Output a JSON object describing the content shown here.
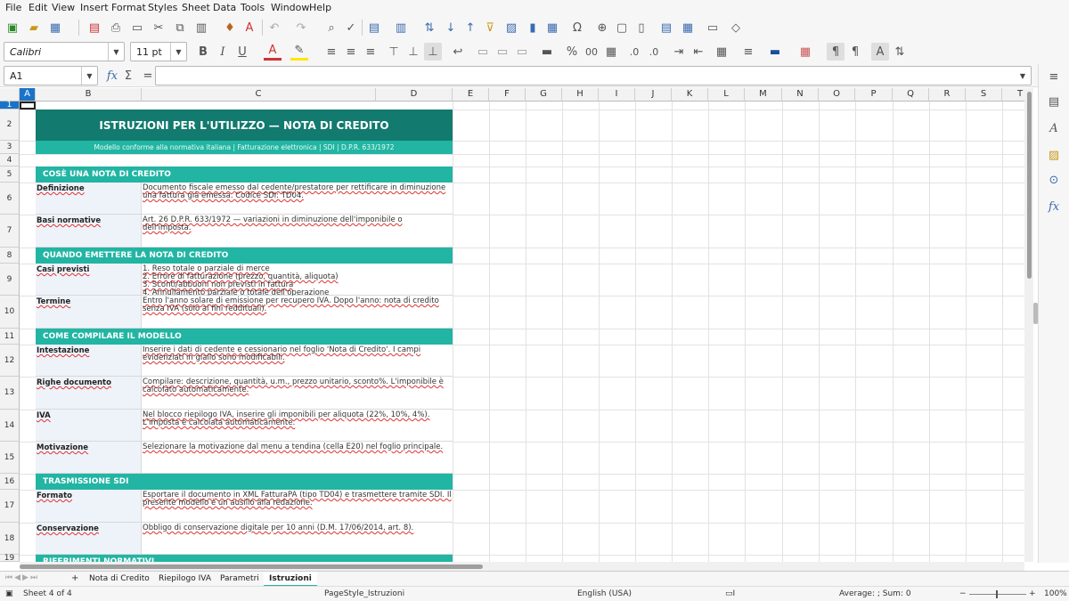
{
  "menu": [
    "File",
    "Edit",
    "View",
    "Insert",
    "Format",
    "Styles",
    "Sheet",
    "Data",
    "Tools",
    "Window",
    "Help"
  ],
  "toolbar": {
    "font_name": "Calibri",
    "font_size": "11 pt",
    "bold": "B",
    "italic": "I",
    "underline": "U"
  },
  "formula_bar": {
    "cell_ref": "A1",
    "fx_label": "fx",
    "sigma_label": "Σ",
    "equals_label": "=",
    "content": ""
  },
  "columns": [
    "A",
    "B",
    "C",
    "D",
    "E",
    "F",
    "G",
    "H",
    "I",
    "J",
    "K",
    "L",
    "M",
    "N",
    "O",
    "P",
    "Q",
    "R",
    "S",
    "T"
  ],
  "rows": [
    "1",
    "2",
    "3",
    "4",
    "5",
    "6",
    "7",
    "8",
    "9",
    "10",
    "11",
    "12",
    "13",
    "14",
    "15",
    "16",
    "17",
    "18",
    "19"
  ],
  "sheet": {
    "title": "ISTRUZIONI PER L'UTILIZZO — NOTA DI CREDITO",
    "subtitle": "Modello conforme alla normativa italiana | Fatturazione elettronica | SDI | D.P.R. 633/1972",
    "sections": {
      "s1": "COSÈ UNA NOTA DI CREDITO",
      "s2": "QUANDO EMETTERE LA NOTA DI CREDITO",
      "s3": "COME COMPILARE IL MODELLO",
      "s4": "TRASMISSIONE SDI",
      "s5": "RIFERIMENTI NORMATIVI"
    },
    "items": [
      {
        "label": "Definizione",
        "text": "Documento fiscale emesso dal cedente/prestatore per rettificare in diminuzione una fattura già emessa. Codice SDI: TD04."
      },
      {
        "label": "Basi normative",
        "text": "Art. 26 D.P.R. 633/1972 — variazioni in diminuzione dell'imponibile o dell'imposta."
      },
      {
        "label": "Casi previsti",
        "text": "1. Reso totale o parziale di merce\n2. Errore di fatturazione (prezzo, quantità, aliquota)\n3. Sconti/abbuoni non previsti in fattura\n4. Annullamento parziale o totale dell'operazione"
      },
      {
        "label": "Termine",
        "text": "Entro l'anno solare di emissione per recupero IVA. Dopo l'anno: nota di credito senza IVA (solo ai fini reddituali)."
      },
      {
        "label": "Intestazione",
        "text": "Inserire i dati di cedente e cessionario nel foglio 'Nota di Credito'. I campi evidenziati in giallo sono modificabili."
      },
      {
        "label": "Righe documento",
        "text": "Compilare: descrizione, quantità, u.m., prezzo unitario, sconto%. L'imponibile è calcolato automaticamente."
      },
      {
        "label": "IVA",
        "text": "Nel blocco riepilogo IVA, inserire gli imponibili per aliquota (22%, 10%, 4%). L'imposta è calcolata automaticamente."
      },
      {
        "label": "Motivazione",
        "text": "Selezionare la motivazione dal menu a tendina (cella E20) nel foglio principale."
      },
      {
        "label": "Formato",
        "text": "Esportare il documento in XML FatturaPA (tipo TD04) e trasmettere tramite SDI. Il presente modello è un ausilio alla redazione."
      },
      {
        "label": "Conservazione",
        "text": "Obbligo di conservazione digitale per 10 anni (D.M. 17/06/2014, art. 8)."
      }
    ]
  },
  "tabs": [
    "Nota di Credito",
    "Riepilogo IVA",
    "Parametri",
    "Istruzioni"
  ],
  "status": {
    "sheet": "Sheet 4 of 4",
    "page_style": "PageStyle_Istruzioni",
    "language": "English (USA)",
    "aggregate": "Average: ; Sum: 0",
    "zoom": "100%"
  },
  "colors": {
    "title_bg": "#127a6e",
    "section_bg": "#22b5a3",
    "label_bg": "#eef3fa",
    "selected_header": "#1a73c8"
  }
}
